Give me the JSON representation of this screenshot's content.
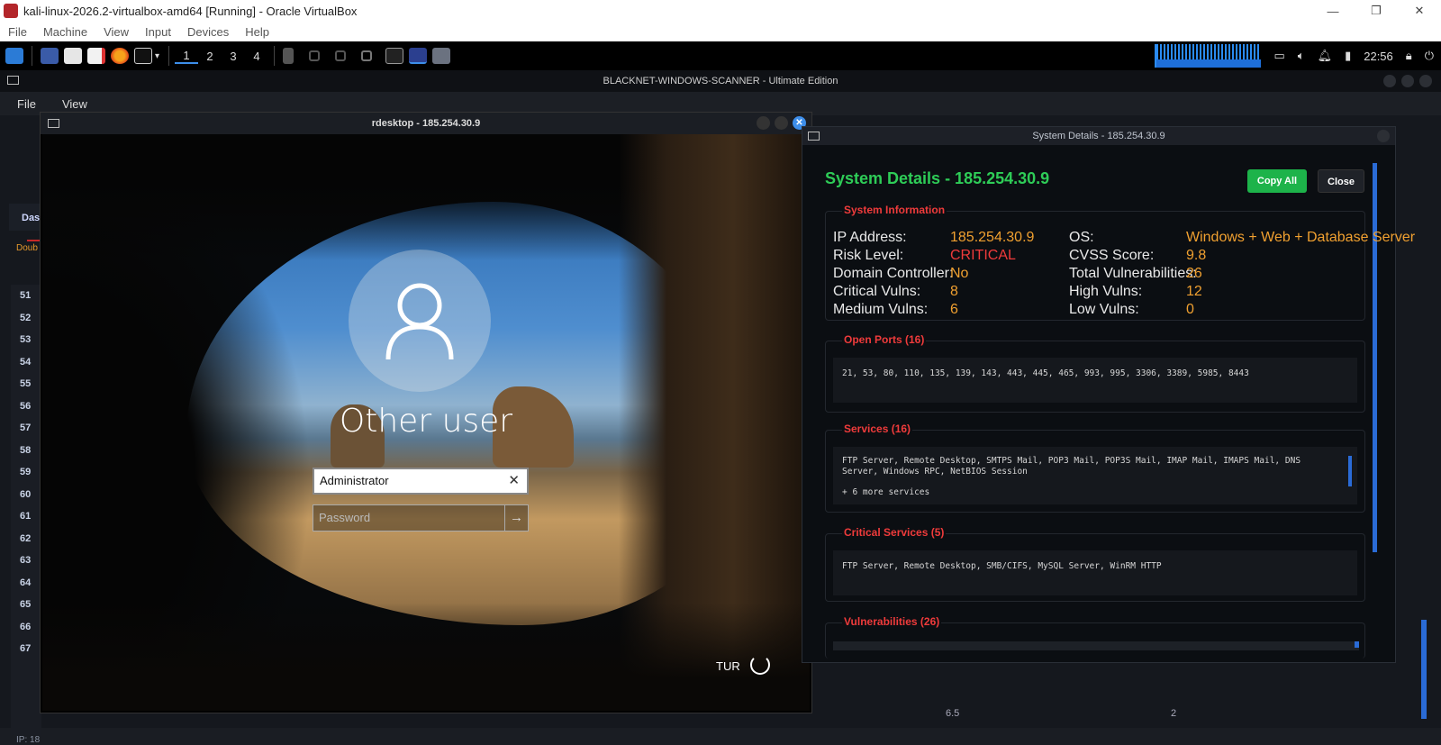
{
  "host": {
    "title": "kali-linux-2026.2-virtualbox-amd64 [Running] - Oracle VirtualBox",
    "menu": [
      "File",
      "Machine",
      "View",
      "Input",
      "Devices",
      "Help"
    ],
    "controls": {
      "minimize": "—",
      "restore": "❐",
      "close": "✕"
    }
  },
  "panel": {
    "workspaces": [
      "1",
      "2",
      "3",
      "4"
    ],
    "clock": "22:56",
    "icons": [
      "kali-menu-icon",
      "desktop-icon",
      "files-icon",
      "text-editor-icon",
      "firefox-icon",
      "terminal-icon",
      "chevron-down-icon",
      "window-thumb-icon",
      "monitor-icon",
      "volume-icon",
      "bell-icon",
      "battery-icon",
      "lock-icon",
      "power-icon"
    ]
  },
  "scanner": {
    "title": "BLACKNET-WINDOWS-SCANNER - Ultimate Edition",
    "menu": [
      "File",
      "View"
    ],
    "tab_partial": "Das",
    "hint_partial": "Doub",
    "row_numbers": [
      "51",
      "52",
      "53",
      "54",
      "55",
      "56",
      "57",
      "58",
      "59",
      "60",
      "61",
      "62",
      "63",
      "64",
      "65",
      "66",
      "67"
    ],
    "status_partial": "IP: 18",
    "bg_values": [
      "6.5",
      "2"
    ]
  },
  "rdesktop": {
    "title": "rdesktop - 185.254.30.9",
    "login": {
      "user_label": "Other user",
      "username_value": "Administrator",
      "password_placeholder": "Password",
      "clear_glyph": "✕",
      "submit_glyph": "→",
      "language": "TUR"
    }
  },
  "details": {
    "window_title": "System Details - 185.254.30.9",
    "heading": "System Details - 185.254.30.9",
    "copy_label": "Copy All",
    "close_label": "Close",
    "system_info": {
      "label": "System Information",
      "rows": [
        {
          "k1": "IP Address:",
          "v1": "185.254.30.9",
          "k2": "OS:",
          "v2": "Windows + Web + Database Server"
        },
        {
          "k1": "Risk Level:",
          "v1": "CRITICAL",
          "k2": "CVSS Score:",
          "v2": "9.8"
        },
        {
          "k1": "Domain Controller:",
          "v1": "No",
          "k2": "Total Vulnerabilities:",
          "v2": "26"
        },
        {
          "k1": "Critical Vulns:",
          "v1": "8",
          "k2": "High Vulns:",
          "v2": "12"
        },
        {
          "k1": "Medium Vulns:",
          "v1": "6",
          "k2": "Low Vulns:",
          "v2": "0"
        }
      ]
    },
    "open_ports": {
      "label": "Open Ports (16)",
      "text": "21, 53, 80, 110, 135, 139, 143, 443, 445, 465, 993, 995, 3306, 3389, 5985, 8443"
    },
    "services": {
      "label": "Services (16)",
      "text": "FTP Server, Remote Desktop, SMTPS Mail, POP3 Mail, POP3S Mail, IMAP Mail, IMAPS Mail, DNS Server, Windows RPC, NetBIOS Session",
      "more": "+ 6 more services"
    },
    "critical_services": {
      "label": "Critical Services (5)",
      "text": "FTP Server, Remote Desktop, SMB/CIFS, MySQL Server, WinRM HTTP"
    },
    "vulnerabilities": {
      "label": "Vulnerabilities (26)"
    }
  },
  "colors": {
    "accent_green": "#2ecc57",
    "value_orange": "#f0a030",
    "critical_red": "#ef3b3b",
    "scroll_blue": "#2a6bd6"
  }
}
